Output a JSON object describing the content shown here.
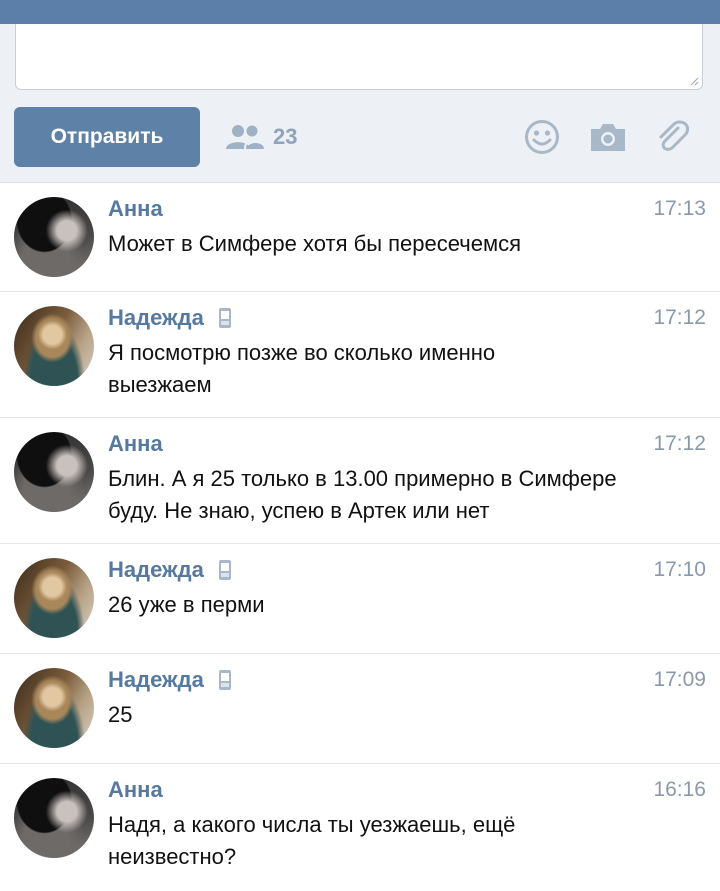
{
  "compose": {
    "send_label": "Отправить",
    "recipients_count": "23"
  },
  "messages": [
    {
      "author": "Анна",
      "time": "17:13",
      "text": "Может в Симфере хотя бы пересечемся",
      "mobile": false,
      "avatar": "anna"
    },
    {
      "author": "Надежда",
      "time": "17:12",
      "text": "Я посмотрю позже во сколько именно выезжаем",
      "mobile": true,
      "avatar": "nadezhda"
    },
    {
      "author": "Анна",
      "time": "17:12",
      "text": "Блин. А я 25 только в 13.00 примерно в Симфере буду. Не знаю, успею в Артек или нет",
      "mobile": false,
      "avatar": "anna"
    },
    {
      "author": "Надежда",
      "time": "17:10",
      "text": "26 уже в перми",
      "mobile": true,
      "avatar": "nadezhda"
    },
    {
      "author": "Надежда",
      "time": "17:09",
      "text": "25",
      "mobile": true,
      "avatar": "nadezhda"
    },
    {
      "author": "Анна",
      "time": "16:16",
      "text": "Надя, а какого числа ты уезжаешь, ещё неизвестно?",
      "mobile": false,
      "avatar": "anna"
    }
  ],
  "icons": {
    "recipients": "group-icon",
    "emoji": "smiley-icon",
    "photo": "camera-icon",
    "attach": "paperclip-icon",
    "mobile": "phone-icon"
  },
  "colors": {
    "header": "#5b7fa8",
    "send_button": "#5e81a8",
    "author_name": "#56799f",
    "icon": "#a8b8c9"
  }
}
